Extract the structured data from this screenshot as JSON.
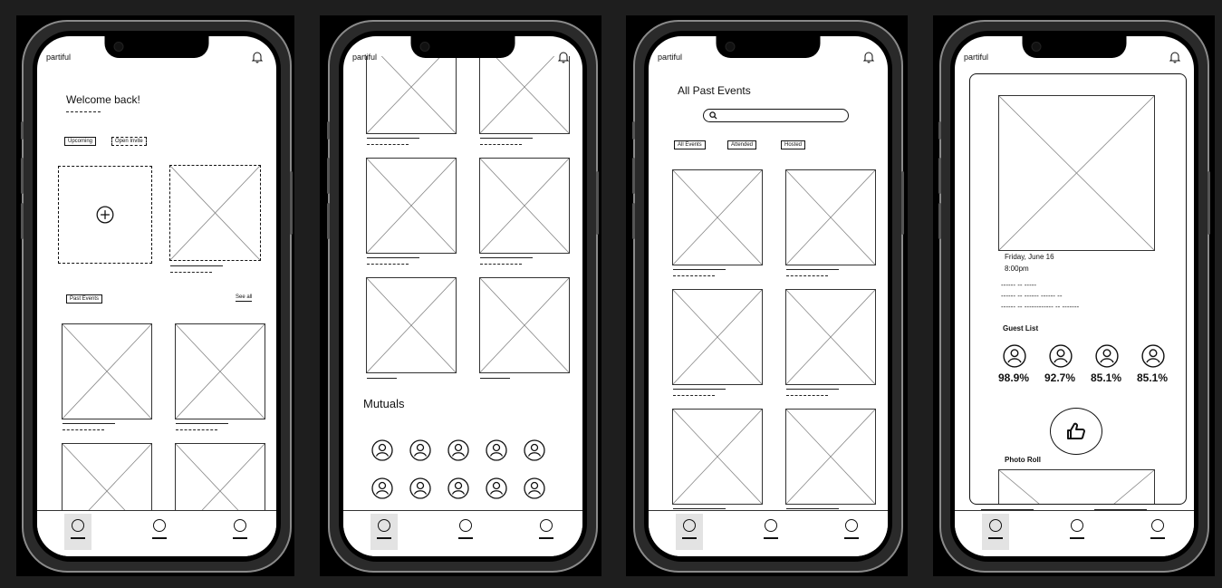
{
  "app": {
    "logo": "partiful"
  },
  "phone1": {
    "welcome": "Welcome back!",
    "chip_upcoming": "Upcoming",
    "chip_open_invite": "Open Invite",
    "past_events_label": "Past Events",
    "see_all": "See all"
  },
  "phone2": {
    "mutuals_label": "Mutuals"
  },
  "phone3": {
    "title": "All Past Events",
    "search_placeholder": "",
    "filters": [
      "All Events",
      "Attended",
      "Hosted"
    ]
  },
  "phone4": {
    "date": "Friday, June 16",
    "time": "8:00pm",
    "detail_lines": [
      "------ -- -----",
      "------ -- ------ ------ --",
      "------ -- ------------ -- -------"
    ],
    "guest_list_label": "Guest List",
    "guests": [
      {
        "match": "98.9%"
      },
      {
        "match": "92.7%"
      },
      {
        "match": "85.1%"
      },
      {
        "match": "85.1%"
      }
    ],
    "photo_roll_label": "Photo Roll"
  },
  "icons": {
    "bell": "bell-icon",
    "plus": "plus-circle-icon",
    "search": "search-icon",
    "thumbs_up": "thumbs-up-icon",
    "avatar": "user-avatar-icon",
    "tab": "tab-icon"
  },
  "colors": {
    "background": "#1e1e1e",
    "screen": "#ffffff",
    "ink": "#111111"
  }
}
